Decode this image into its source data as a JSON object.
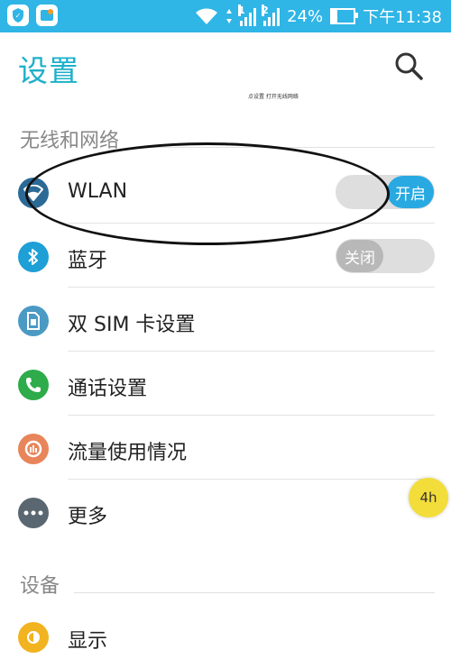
{
  "status_bar": {
    "sim_slot_1": "1",
    "sim_slot_2": "2",
    "battery_percent": "24%",
    "battery_level": 0.24,
    "time": "下午11:38"
  },
  "header": {
    "title": "设置",
    "hint": "点设置 打开无线网络"
  },
  "sections": {
    "wireless": "无线和网络",
    "device": "设备"
  },
  "items": [
    {
      "label": "WLAN",
      "icon": "wifi-icon",
      "toggle": "开启",
      "toggle_on": true
    },
    {
      "label": "蓝牙",
      "icon": "bluetooth-icon",
      "toggle": "关闭",
      "toggle_on": false
    },
    {
      "label": "双 SIM 卡设置",
      "icon": "sim-card-icon"
    },
    {
      "label": "通话设置",
      "icon": "phone-icon"
    },
    {
      "label": "流量使用情况",
      "icon": "data-usage-icon"
    },
    {
      "label": "更多",
      "icon": "more-icon"
    }
  ],
  "device_items": [
    {
      "label": "显示",
      "icon": "display-icon"
    }
  ],
  "floating_badge": "4h",
  "colors": {
    "accent": "#2fb5e6",
    "title": "#1eb0c9",
    "toggle_on": "#29a9e1",
    "toggle_off": "#b8b8b8"
  }
}
